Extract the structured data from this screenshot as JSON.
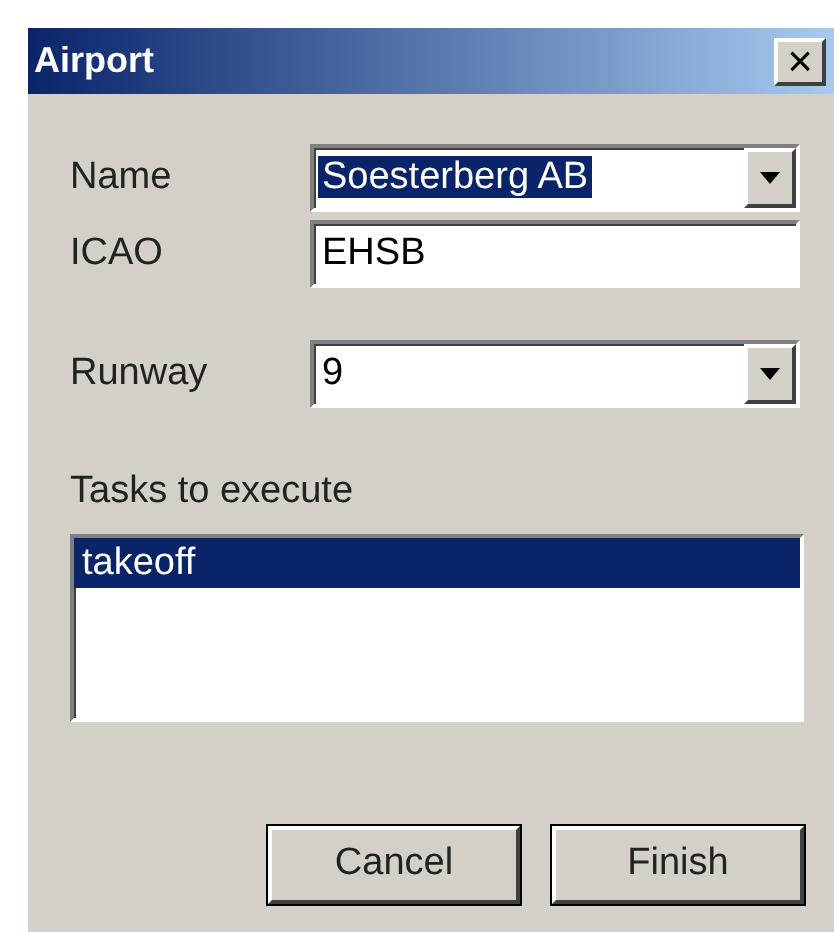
{
  "window": {
    "title": "Airport",
    "close": "×"
  },
  "fields": [
    {
      "kind": "combo",
      "label": "Name",
      "value": "Soesterberg AB",
      "text_highlighted": true
    },
    {
      "kind": "text",
      "label": "ICAO",
      "value": "EHSB",
      "text_highlighted": false
    },
    {
      "kind": "combo",
      "label": "Runway",
      "value": "9",
      "text_highlighted": false
    }
  ],
  "tasks": {
    "label": "Tasks to execute",
    "items": [
      {
        "label": "takeoff",
        "selected": true
      }
    ]
  },
  "buttons": [
    "Cancel",
    "Finish"
  ]
}
